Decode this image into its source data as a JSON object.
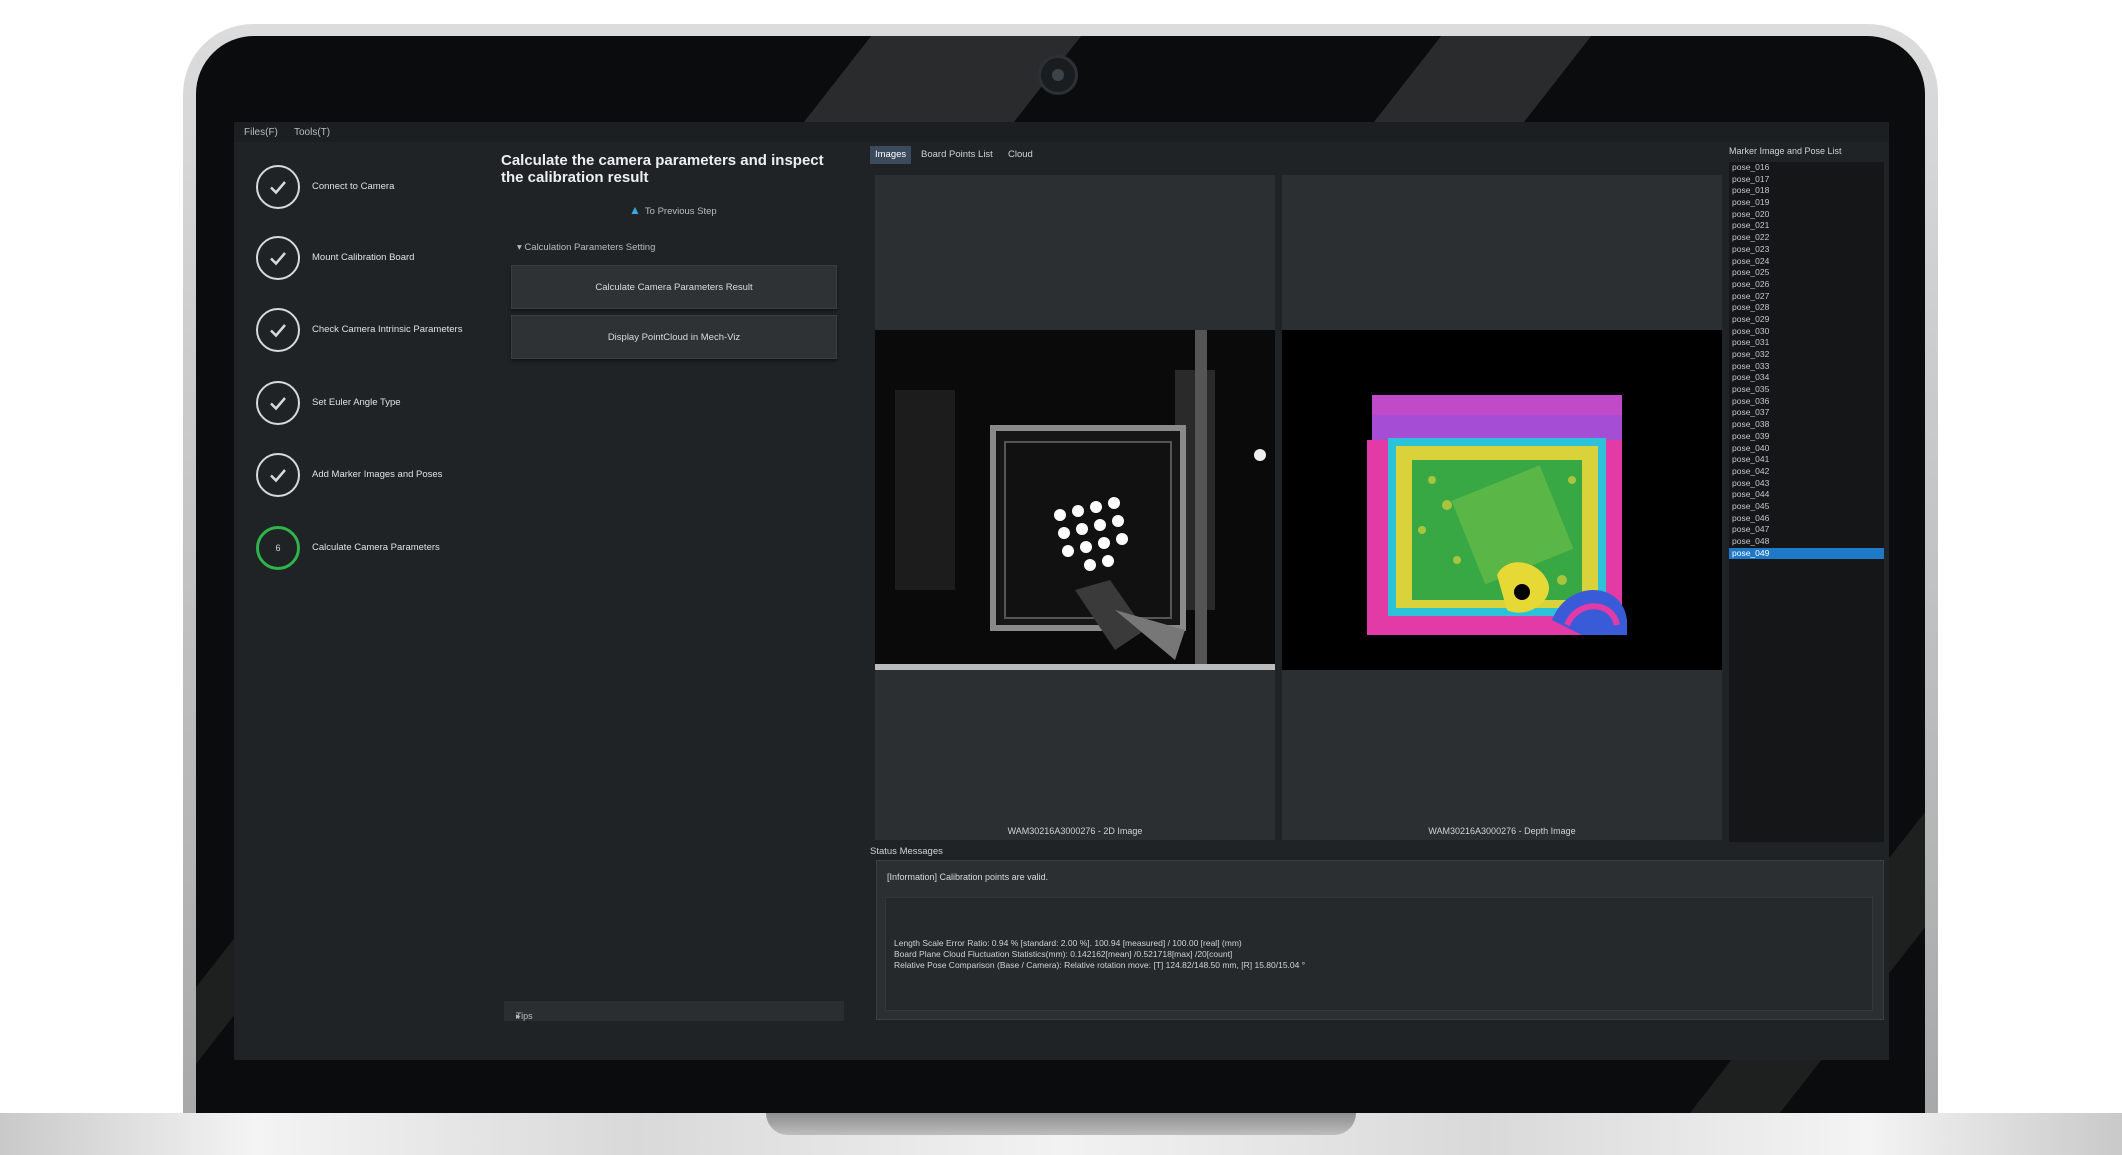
{
  "menu": {
    "files": "Files(F)",
    "tools": "Tools(T)"
  },
  "steps": [
    {
      "label": "Connect to Camera",
      "state": "done"
    },
    {
      "label": "Mount Calibration Board",
      "state": "done"
    },
    {
      "label": "Check Camera Intrinsic Parameters",
      "state": "done"
    },
    {
      "label": "Set Euler Angle Type",
      "state": "done"
    },
    {
      "label": "Add Marker Images and Poses",
      "state": "done"
    },
    {
      "label": "Calculate Camera Parameters",
      "state": "active",
      "number": "6"
    }
  ],
  "middle": {
    "title": "Calculate the camera parameters and inspect the calibration result",
    "prev_step": "To Previous Step",
    "section_header": "Calculation Parameters Setting",
    "calc_button": "Calculate Camera Parameters Result",
    "display_button": "Display PointCloud in Mech-Viz",
    "tips": "Tips"
  },
  "tabs": [
    {
      "label": "Images",
      "active": true
    },
    {
      "label": "Board Points List",
      "active": false
    },
    {
      "label": "Cloud",
      "active": false
    }
  ],
  "images": {
    "left_caption": "WAM30216A3000276 - 2D Image",
    "right_caption": "WAM30216A3000276 - Depth Image"
  },
  "pose_list": {
    "title": "Marker Image and Pose List",
    "items": [
      "pose_016",
      "pose_017",
      "pose_018",
      "pose_019",
      "pose_020",
      "pose_021",
      "pose_022",
      "pose_023",
      "pose_024",
      "pose_025",
      "pose_026",
      "pose_027",
      "pose_028",
      "pose_029",
      "pose_030",
      "pose_031",
      "pose_032",
      "pose_033",
      "pose_034",
      "pose_035",
      "pose_036",
      "pose_037",
      "pose_038",
      "pose_039",
      "pose_040",
      "pose_041",
      "pose_042",
      "pose_043",
      "pose_044",
      "pose_045",
      "pose_046",
      "pose_047",
      "pose_048",
      "pose_049"
    ],
    "selected": "pose_049"
  },
  "status": {
    "label": "Status Messages",
    "info": "[Information] Calibration points are valid.",
    "lines": [
      "Length Scale Error Ratio: 0.94 % [standard: 2.00 %]. 100.94 [measured] / 100.00 [real] (mm)",
      "Board Plane Cloud Fluctuation Statistics(mm): 0.142162[mean] /0.521718[max] /20[count]",
      "Relative Pose Comparison (Base / Camera): Relative rotation move: [T] 124.82/148.50 mm, [R] 15.80/15.04 °"
    ]
  },
  "colors": {
    "active_step": "#2fb34a",
    "selected_item": "#1f78c8",
    "accent_arrow": "#3aa6e4",
    "background": "#202325"
  },
  "icons": {
    "step_done": "check-circle-icon",
    "prev_step": "chevron-up-icon",
    "section_toggle": "caret-down-icon",
    "tips_toggle": "caret-right-icon"
  }
}
